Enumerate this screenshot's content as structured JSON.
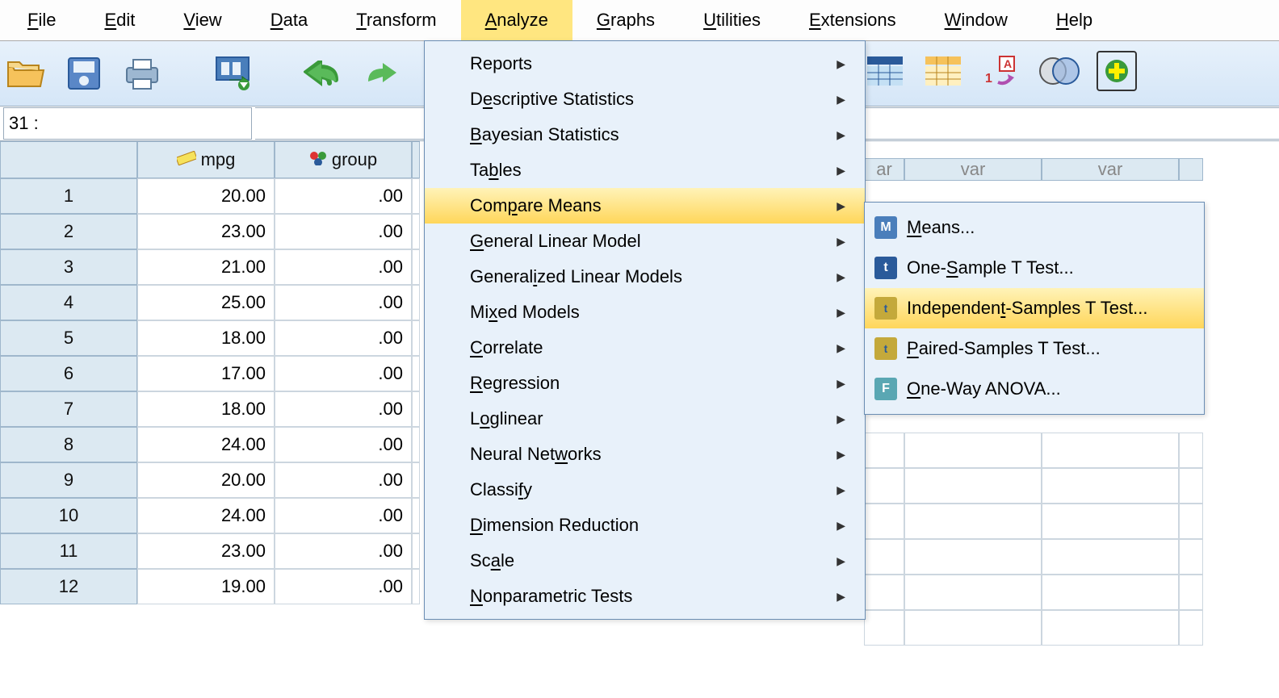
{
  "menu": {
    "items": [
      "File",
      "Edit",
      "View",
      "Data",
      "Transform",
      "Analyze",
      "Graphs",
      "Utilities",
      "Extensions",
      "Window",
      "Help"
    ],
    "active": "Analyze"
  },
  "cell_ref": "31 :",
  "columns": [
    "mpg",
    "group"
  ],
  "placeholder_cols": [
    "var",
    "var",
    "var"
  ],
  "far_placeholder_cols": [
    "ar",
    "var",
    "var"
  ],
  "rows": [
    {
      "n": "1",
      "mpg": "20.00",
      "group": ".00"
    },
    {
      "n": "2",
      "mpg": "23.00",
      "group": ".00"
    },
    {
      "n": "3",
      "mpg": "21.00",
      "group": ".00"
    },
    {
      "n": "4",
      "mpg": "25.00",
      "group": ".00"
    },
    {
      "n": "5",
      "mpg": "18.00",
      "group": ".00"
    },
    {
      "n": "6",
      "mpg": "17.00",
      "group": ".00"
    },
    {
      "n": "7",
      "mpg": "18.00",
      "group": ".00"
    },
    {
      "n": "8",
      "mpg": "24.00",
      "group": ".00"
    },
    {
      "n": "9",
      "mpg": "20.00",
      "group": ".00"
    },
    {
      "n": "10",
      "mpg": "24.00",
      "group": ".00"
    },
    {
      "n": "11",
      "mpg": "23.00",
      "group": ".00"
    },
    {
      "n": "12",
      "mpg": "19.00",
      "group": ".00"
    }
  ],
  "analyze_menu": [
    {
      "label": "Reports",
      "underline": -1
    },
    {
      "label": "Descriptive Statistics",
      "underline": 1
    },
    {
      "label": "Bayesian Statistics",
      "underline": 0
    },
    {
      "label": "Tables",
      "underline": 2
    },
    {
      "label": "Compare Means",
      "underline": 3,
      "highlight": true
    },
    {
      "label": "General Linear Model",
      "underline": 0
    },
    {
      "label": "Generalized Linear Models",
      "underline": 7
    },
    {
      "label": "Mixed Models",
      "underline": 2
    },
    {
      "label": "Correlate",
      "underline": 0
    },
    {
      "label": "Regression",
      "underline": 0
    },
    {
      "label": "Loglinear",
      "underline": 1
    },
    {
      "label": "Neural Networks",
      "underline": 10
    },
    {
      "label": "Classify",
      "underline": 6
    },
    {
      "label": "Dimension Reduction",
      "underline": 0
    },
    {
      "label": "Scale",
      "underline": 2
    },
    {
      "label": "Nonparametric Tests",
      "underline": 0
    }
  ],
  "compare_means_submenu": [
    {
      "label": "Means...",
      "underline": 0,
      "icon": "M",
      "iconClass": "icon-blue"
    },
    {
      "label": "One-Sample T Test...",
      "underline": 4,
      "icon": "t",
      "iconClass": "icon-navy"
    },
    {
      "label": "Independent-Samples T Test...",
      "underline": 10,
      "icon": "t",
      "iconClass": "icon-yellow",
      "highlight": true
    },
    {
      "label": "Paired-Samples T Test...",
      "underline": 0,
      "icon": "t",
      "iconClass": "icon-yellow"
    },
    {
      "label": "One-Way ANOVA...",
      "underline": 0,
      "icon": "F",
      "iconClass": "icon-cyan"
    }
  ]
}
